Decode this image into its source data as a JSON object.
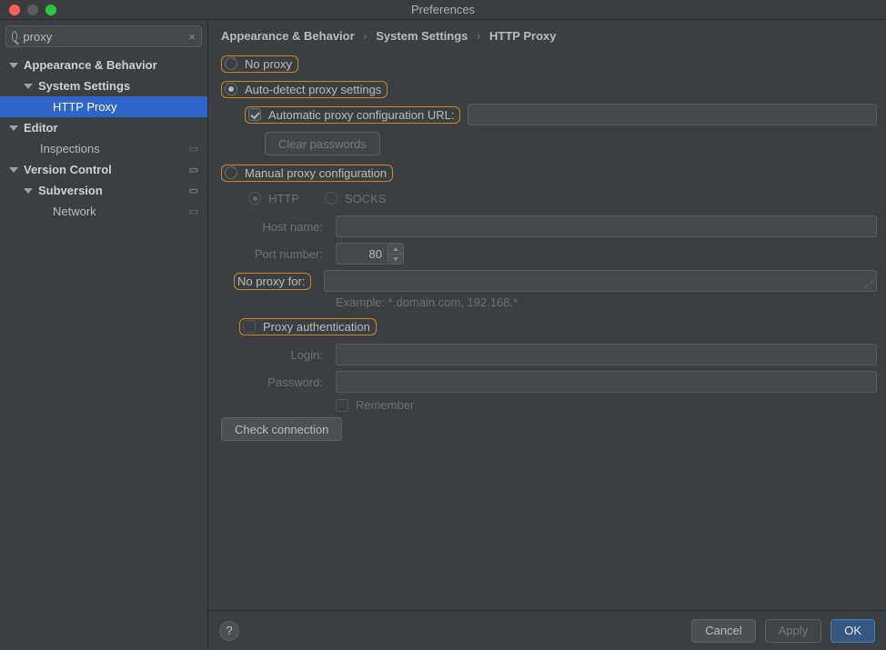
{
  "window": {
    "title": "Preferences"
  },
  "search": {
    "value": "proxy"
  },
  "tree": {
    "appearance": "Appearance & Behavior",
    "system_settings": "System Settings",
    "http_proxy": "HTTP Proxy",
    "editor": "Editor",
    "inspections": "Inspections",
    "version_control": "Version Control",
    "subversion": "Subversion",
    "network": "Network"
  },
  "breadcrumb": {
    "a": "Appearance & Behavior",
    "b": "System Settings",
    "c": "HTTP Proxy",
    "sep": "›"
  },
  "proxy": {
    "no_proxy": "No proxy",
    "auto_detect": "Auto-detect proxy settings",
    "auto_url_label": "Automatic proxy configuration URL:",
    "auto_url_value": "",
    "clear_passwords": "Clear passwords",
    "manual": "Manual proxy configuration",
    "http": "HTTP",
    "socks": "SOCKS",
    "host_label": "Host name:",
    "host_value": "",
    "port_label": "Port number:",
    "port_value": "80",
    "no_proxy_for_label": "No proxy for:",
    "no_proxy_for_value": "",
    "example": "Example: *.domain.com, 192.168.*",
    "proxy_auth": "Proxy authentication",
    "login_label": "Login:",
    "login_value": "",
    "password_label": "Password:",
    "password_value": "",
    "remember": "Remember",
    "check_connection": "Check connection"
  },
  "footer": {
    "cancel": "Cancel",
    "apply": "Apply",
    "ok": "OK",
    "help": "?"
  }
}
